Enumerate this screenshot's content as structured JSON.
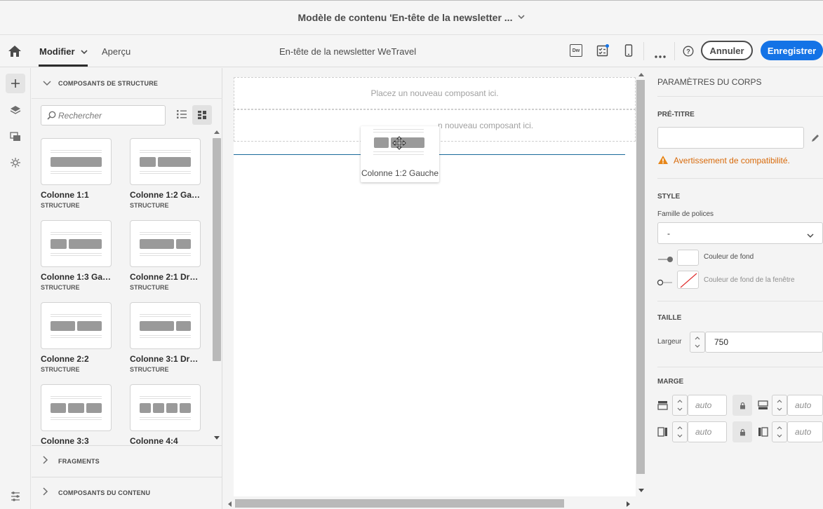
{
  "header": {
    "title": "Modèle de contenu 'En-tête de la newsletter ..."
  },
  "toolbar": {
    "modify_label": "Modifier",
    "preview_label": "Aperçu",
    "doc_title": "En-tête de la newsletter WeTravel",
    "dw_label": "Dw",
    "cancel_label": "Annuler",
    "save_label": "Enregistrer"
  },
  "left_panel": {
    "structure_header": "COMPOSANTS DE STRUCTURE",
    "search_placeholder": "Rechercher",
    "components": [
      {
        "name": "Colonne 1:1",
        "type": "STRUCTURE"
      },
      {
        "name": "Colonne 1:2 Gau...",
        "type": "STRUCTURE"
      },
      {
        "name": "Colonne 1:3 Gau...",
        "type": "STRUCTURE"
      },
      {
        "name": "Colonne 2:1 Droite",
        "type": "STRUCTURE"
      },
      {
        "name": "Colonne 2:2",
        "type": "STRUCTURE"
      },
      {
        "name": "Colonne 3:1 Droite",
        "type": "STRUCTURE"
      },
      {
        "name": "Colonne 3:3",
        "type": ""
      },
      {
        "name": "Colonne 4:4",
        "type": ""
      }
    ],
    "fragments_header": "FRAGMENTS",
    "content_header": "COMPOSANTS DU CONTENU"
  },
  "canvas": {
    "drop_zone_1": "Placez un nouveau composant ici.",
    "drop_zone_2": "n nouveau composant ici.",
    "drag_label": "Colonne 1:2 Gauche"
  },
  "right_panel": {
    "title": "PARAMÈTRES DU CORPS",
    "pretitle_header": "PRÉ-TITRE",
    "warning": "Avertissement de compatibilité.",
    "style_header": "STYLE",
    "font_family_label": "Famille de polices",
    "font_family_value": "-",
    "bg_color_label": "Couleur de fond",
    "window_bg_label": "Couleur de fond de la fenêtre",
    "size_header": "TAILLE",
    "width_label": "Largeur",
    "width_value": "750",
    "margin_header": "MARGE",
    "margin_placeholder": "auto"
  },
  "colors": {
    "accent": "#1473e6",
    "warning": "#e68619"
  }
}
